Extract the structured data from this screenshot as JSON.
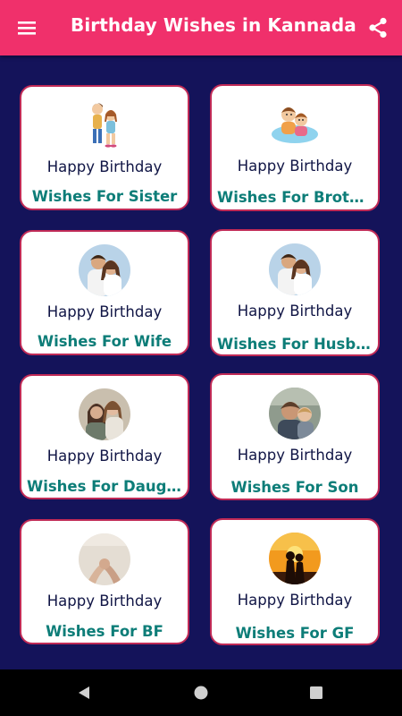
{
  "app_bar": {
    "title": "Birthday Wishes in Kannada",
    "menu_icon": "hamburger-menu-icon",
    "share_icon": "share-icon",
    "background": "#f0306b"
  },
  "cards": [
    {
      "line1": "Happy Birthday",
      "line2": "Wishes For Sister",
      "image": "sister-kids-illustration"
    },
    {
      "line1": "Happy Birthday",
      "line2": "Wishes For Brother",
      "image": "brothers-illustration"
    },
    {
      "line1": "Happy Birthday",
      "line2": "Wishes For Wife",
      "image": "couple-photo"
    },
    {
      "line1": "Happy Birthday",
      "line2": "Wishes For Husba...",
      "image": "couple-photo"
    },
    {
      "line1": "Happy Birthday",
      "line2": "Wishes For Daught...",
      "image": "mother-daughter-photo"
    },
    {
      "line1": "Happy Birthday",
      "line2": "Wishes For Son",
      "image": "father-son-photo"
    },
    {
      "line1": "Happy Birthday",
      "line2": "Wishes For BF",
      "image": "holding-hands-photo"
    },
    {
      "line1": "Happy Birthday",
      "line2": "Wishes For GF",
      "image": "sunset-couple-photo"
    }
  ],
  "nav_bar": {
    "back_icon": "back-triangle-icon",
    "home_icon": "home-circle-icon",
    "recents_icon": "recents-square-icon"
  },
  "colors": {
    "background": "#14135a",
    "card_border": "#c02a56",
    "heading_text": "#101545",
    "category_text": "#0d7d78"
  }
}
